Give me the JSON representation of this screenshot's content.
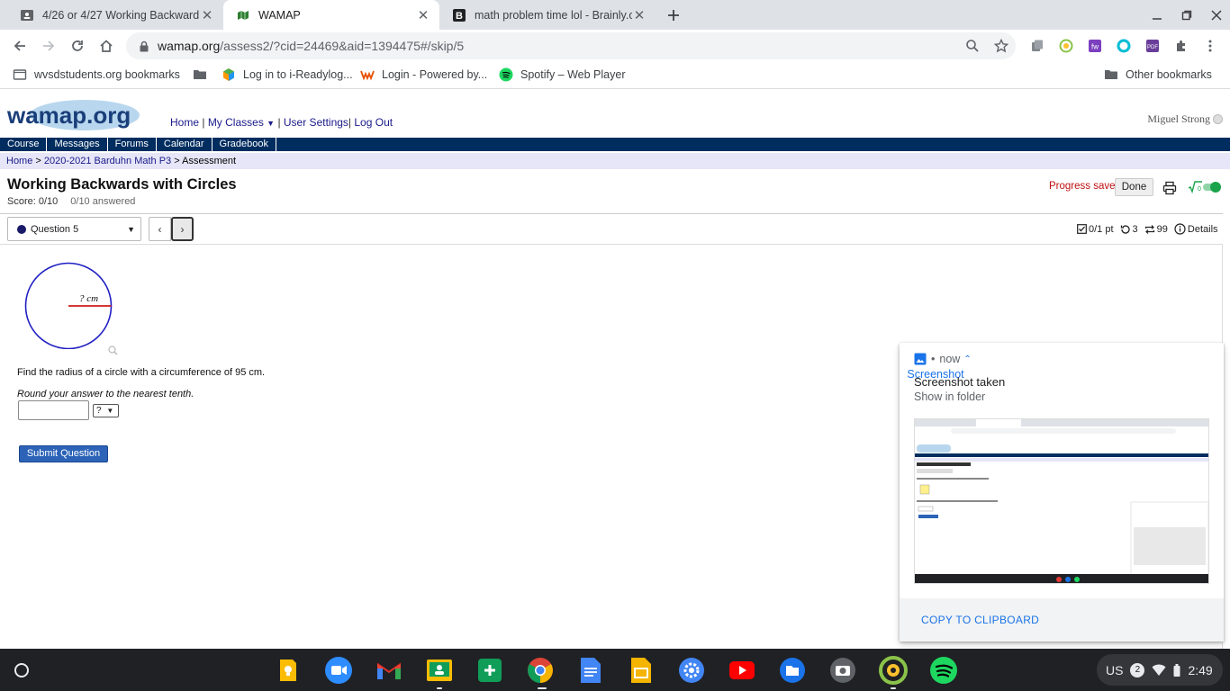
{
  "browser": {
    "tabs": [
      {
        "title": "4/26 or 4/27 Working Backward",
        "icon": "classroom-icon",
        "active": false
      },
      {
        "title": "WAMAP",
        "icon": "wamap-icon",
        "active": true
      },
      {
        "title": "math problem time lol - Brainly.c",
        "icon": "brainly-icon",
        "active": false
      }
    ],
    "url_host": "wamap.org",
    "url_path": "/assess2/?cid=24469&aid=1394475#/skip/5",
    "bookmarks": [
      {
        "label": "wvsdstudents.org bookmarks",
        "icon": "folder-outline-icon"
      },
      {
        "label": "",
        "icon": "folder-icon"
      },
      {
        "label": "Log in to i-Readylog...",
        "icon": "iready-icon"
      },
      {
        "label": "Login - Powered by...",
        "icon": "w-icon"
      },
      {
        "label": "Spotify – Web Player",
        "icon": "spotify-icon"
      }
    ],
    "other_bookmarks": "Other bookmarks"
  },
  "site": {
    "logo_text": "wamap.org",
    "top_links": [
      "Home",
      "My Classes",
      "User Settings",
      "Log Out"
    ],
    "user_name": "Miguel Strong",
    "nav": [
      "Course",
      "Messages",
      "Forums",
      "Calendar",
      "Gradebook"
    ],
    "breadcrumb": [
      "Home",
      "2020-2021 Barduhn Math P3",
      "Assessment"
    ]
  },
  "assessment": {
    "title": "Working Backwards with Circles",
    "score": "Score: 0/10",
    "answered": "0/10 answered",
    "progress_status": "Progress saved",
    "done_label": "Done",
    "question_select": "Question 5",
    "points": "0/1 pt",
    "retries": "3",
    "regens": "99",
    "details": "Details"
  },
  "question": {
    "circle_label": "? cm",
    "text": "Find the radius of a circle with a circumference of 95 cm.",
    "hint": "Round your answer to the nearest tenth.",
    "answer_value": "",
    "unit_selected": "?",
    "submit_label": "Submit Question"
  },
  "notification": {
    "app": "Screenshot",
    "time": "now",
    "title": "Screenshot taken",
    "subtitle": "Show in folder",
    "action": "COPY TO CLIPBOARD"
  },
  "shelf": {
    "apps": [
      "keep-icon",
      "zoom-icon",
      "gmail-icon",
      "classroom-icon",
      "sheets-icon",
      "chrome-icon",
      "docs-icon",
      "slides-icon",
      "settings-icon",
      "youtube-icon",
      "files-icon",
      "camera-icon",
      "iready-icon",
      "spotify-icon"
    ],
    "locale": "US",
    "notifications": "2",
    "time": "2:49"
  },
  "colors": {
    "nav_bar": "#002d5f",
    "breadcrumb_bg": "#e6e6f8",
    "submit": "#2c63b7",
    "progress_text": "#c01010",
    "toggle": "#1aa34a"
  }
}
